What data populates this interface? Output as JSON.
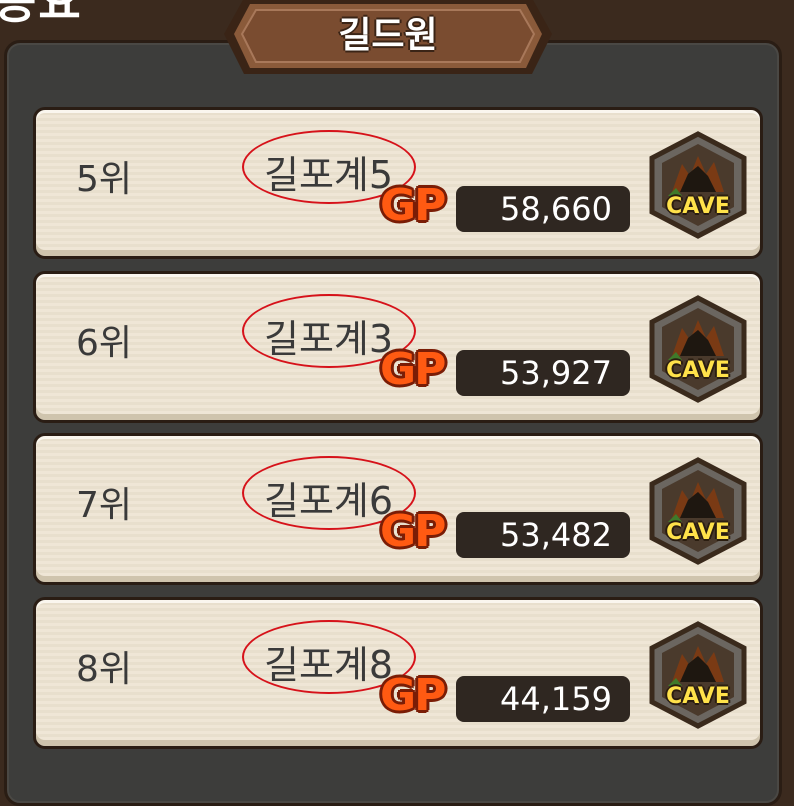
{
  "top_fragment": "공요",
  "header": {
    "title": "길드원"
  },
  "members": [
    {
      "rank": "5위",
      "name": "길포계5",
      "gp_label": "GP",
      "gp": "58,660",
      "badge": "CAVE"
    },
    {
      "rank": "6위",
      "name": "길포계3",
      "gp_label": "GP",
      "gp": "53,927",
      "badge": "CAVE"
    },
    {
      "rank": "7위",
      "name": "길포계6",
      "gp_label": "GP",
      "gp": "53,482",
      "badge": "CAVE"
    },
    {
      "rank": "8위",
      "name": "길포계8",
      "gp_label": "GP",
      "gp": "44,159",
      "badge": "CAVE"
    }
  ],
  "colors": {
    "annotation_circle": "#d6121a",
    "gp_orange": "#ff5a12",
    "cave_yellow": "#ffe24a"
  }
}
